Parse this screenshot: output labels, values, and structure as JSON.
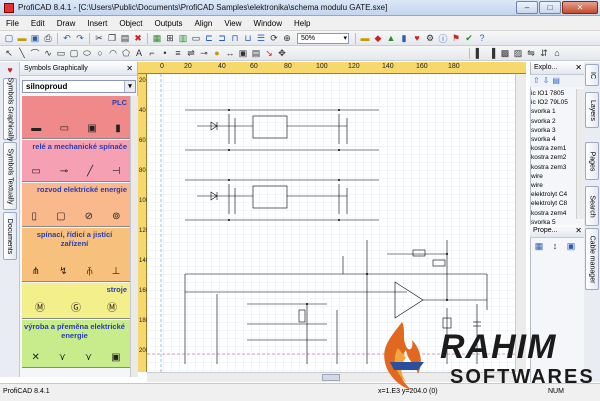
{
  "window": {
    "title": "ProfiCAD 8.4.1 - [C:\\Users\\Public\\Documents\\ProfiCAD Samples\\elektronika\\schema modulu GATE.sxe]",
    "minimize": "–",
    "maximize": "□",
    "close": "✕"
  },
  "menu": [
    "File",
    "Edit",
    "Draw",
    "Insert",
    "Object",
    "Outputs",
    "Align",
    "View",
    "Window",
    "Help"
  ],
  "toolbar": {
    "zoom_value": "50%"
  },
  "left_tabs": [
    "Symbols Graphically",
    "Symbols Textually",
    "Documents"
  ],
  "symbols_panel": {
    "title": "Symbols Graphically",
    "close": "✕",
    "selected_library": "silnoproud",
    "categories": [
      {
        "name": "PLC",
        "color": "#f08a8a"
      },
      {
        "name": "relé a mechanické spínače",
        "color": "#f6a0b4"
      },
      {
        "name": "rozvod elektrické energie",
        "color": "#f9b98c"
      },
      {
        "name": "spínací, řídicí a jistící zařízení",
        "color": "#f7c07c"
      },
      {
        "name": "stroje",
        "color": "#f3ef8a"
      },
      {
        "name": "výroba a přeměna elektrické energie",
        "color": "#c8ec8c"
      }
    ]
  },
  "ruler": {
    "h_ticks": [
      "0",
      "20",
      "40",
      "60",
      "80",
      "100",
      "120",
      "140",
      "160",
      "180"
    ],
    "v_ticks": [
      "20",
      "40",
      "60",
      "80",
      "100",
      "120",
      "140",
      "160",
      "180",
      "200"
    ]
  },
  "explorer": {
    "title": "Explo...",
    "close": "✕",
    "items": [
      "ic IO1 7805",
      "ic IO2 79L05",
      "svorka 1",
      "svorka 2",
      "svorka 3",
      "svorka 4",
      "kostra zem1",
      "kostra zem2",
      "kostra zem3",
      "wire",
      "wire",
      "elektrolyt C4",
      "elektrolyt C8",
      "kostra zem4",
      "svorka 5"
    ]
  },
  "properties": {
    "title": "Prope...",
    "close": "✕"
  },
  "right_tabs": [
    "IC",
    "Layers",
    "Pages",
    "Search",
    "Cable manager"
  ],
  "status": {
    "left": "ProfiCAD 8.4.1",
    "coords": "x=1.E3   y=204.0 (0)",
    "num": "NUM"
  },
  "watermark": {
    "line1": "RAHIM",
    "line2": "SOFTWARES"
  }
}
